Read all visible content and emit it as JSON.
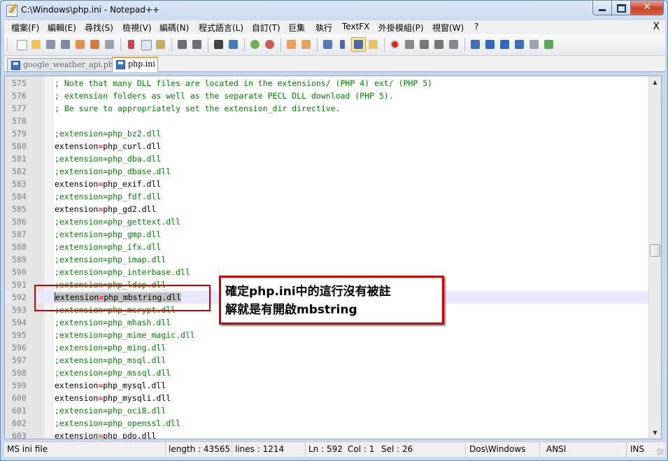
{
  "window": {
    "title": "C:\\Windows\\php.ini - Notepad++"
  },
  "menu": {
    "items": [
      "檔案(F)",
      "編輯(E)",
      "尋找(S)",
      "檢視(V)",
      "編碼(N)",
      "程式語言(L)",
      "自訂(T)",
      "巨集",
      "執行",
      "TextFX",
      "外掛模組(P)",
      "視窗(W)",
      "?"
    ],
    "close": "X"
  },
  "toolbar": {
    "icons": [
      "new-file-icon",
      "open-file-icon",
      "save-icon",
      "save-all-icon",
      "close-file-icon",
      "close-all-icon",
      "print-icon",
      "cut-icon",
      "copy-icon",
      "paste-icon",
      "undo-icon",
      "redo-icon",
      "find-icon",
      "replace-icon",
      "zoom-in-icon",
      "zoom-out-icon",
      "sync-vertical-icon",
      "sync-horizontal-icon",
      "word-wrap-icon",
      "show-all-chars-icon",
      "indent-guide-icon",
      "doc-map-icon",
      "record-macro-icon",
      "stop-macro-icon",
      "play-macro-icon",
      "play-multiple-icon",
      "save-macro-icon",
      "trim-icon",
      "up-icon",
      "down-icon",
      "sort-icon",
      "mark-icon",
      "spellcheck-icon"
    ]
  },
  "tabs": [
    {
      "label": "google_weather_api.php",
      "active": false
    },
    {
      "label": "php.ini",
      "active": true
    }
  ],
  "editor": {
    "lines": [
      {
        "n": "575",
        "type": "comment",
        "text": "; Note that many DLL files are located in the extensions/ (PHP 4) ext/ (PHP 5)"
      },
      {
        "n": "576",
        "type": "comment",
        "text": "; extension folders as well as the separate PECL DLL download (PHP 5)."
      },
      {
        "n": "577",
        "type": "comment",
        "text": "; Be sure to appropriately set the extension_dir directive."
      },
      {
        "n": "578",
        "type": "blank",
        "text": ""
      },
      {
        "n": "579",
        "type": "comment",
        "text": ";extension=php_bz2.dll"
      },
      {
        "n": "580",
        "type": "setting",
        "key": "extension",
        "eq": "=",
        "value": "php_curl.dll"
      },
      {
        "n": "581",
        "type": "comment",
        "text": ";extension=php_dba.dll"
      },
      {
        "n": "582",
        "type": "comment",
        "text": ";extension=php_dbase.dll"
      },
      {
        "n": "583",
        "type": "setting",
        "key": "extension",
        "eq": "=",
        "value": "php_exif.dll"
      },
      {
        "n": "584",
        "type": "comment",
        "text": ";extension=php_fdf.dll"
      },
      {
        "n": "585",
        "type": "setting",
        "key": "extension",
        "eq": "=",
        "value": "php_gd2.dll"
      },
      {
        "n": "586",
        "type": "comment",
        "text": ";extension=php_gettext.dll"
      },
      {
        "n": "587",
        "type": "comment",
        "text": ";extension=php_gmp.dll"
      },
      {
        "n": "588",
        "type": "comment",
        "text": ";extension=php_ifx.dll"
      },
      {
        "n": "589",
        "type": "comment",
        "text": ";extension=php_imap.dll"
      },
      {
        "n": "590",
        "type": "comment",
        "text": ";extension=php_interbase.dll"
      },
      {
        "n": "591",
        "type": "comment",
        "text": ";extension=php_ldap.dll"
      },
      {
        "n": "592",
        "type": "setting",
        "key": "extension",
        "eq": "=",
        "value": "php_mbstring.dll",
        "current": true
      },
      {
        "n": "593",
        "type": "comment",
        "text": ";extension=php_mcrypt.dll"
      },
      {
        "n": "594",
        "type": "comment",
        "text": ";extension=php_mhash.dll"
      },
      {
        "n": "595",
        "type": "comment",
        "text": ";extension=php_mime_magic.dll"
      },
      {
        "n": "596",
        "type": "comment",
        "text": ";extension=php_ming.dll"
      },
      {
        "n": "597",
        "type": "comment",
        "text": ";extension=php_msql.dll"
      },
      {
        "n": "598",
        "type": "comment",
        "text": ";extension=php_mssql.dll"
      },
      {
        "n": "599",
        "type": "setting",
        "key": "extension",
        "eq": "=",
        "value": "php_mysql.dll"
      },
      {
        "n": "600",
        "type": "setting",
        "key": "extension",
        "eq": "=",
        "value": "php_mysqli.dll"
      },
      {
        "n": "601",
        "type": "comment",
        "text": ";extension=php_oci8.dll"
      },
      {
        "n": "602",
        "type": "comment",
        "text": ";extension=php_openssl.dll"
      },
      {
        "n": "603",
        "type": "setting",
        "key": "extension",
        "eq": "=",
        "value": "php_pdo.dll"
      }
    ]
  },
  "annotation": {
    "line1": "確定php.ini中的這行沒有被註",
    "line2": "解就是有開啟mbstring"
  },
  "status": {
    "filetype": "MS ini file",
    "length": "length : 43565",
    "lines": "lines : 1214",
    "ln": "Ln : 592",
    "col": "Col : 1",
    "sel": "Sel : 26",
    "eol": "Dos\\Windows",
    "encoding": "ANSI",
    "mode": "INS"
  },
  "colors": {
    "comment": "#008000",
    "operator": "#ff0000",
    "annotation_border": "#d40000",
    "current_line": "#e8e8ff"
  }
}
